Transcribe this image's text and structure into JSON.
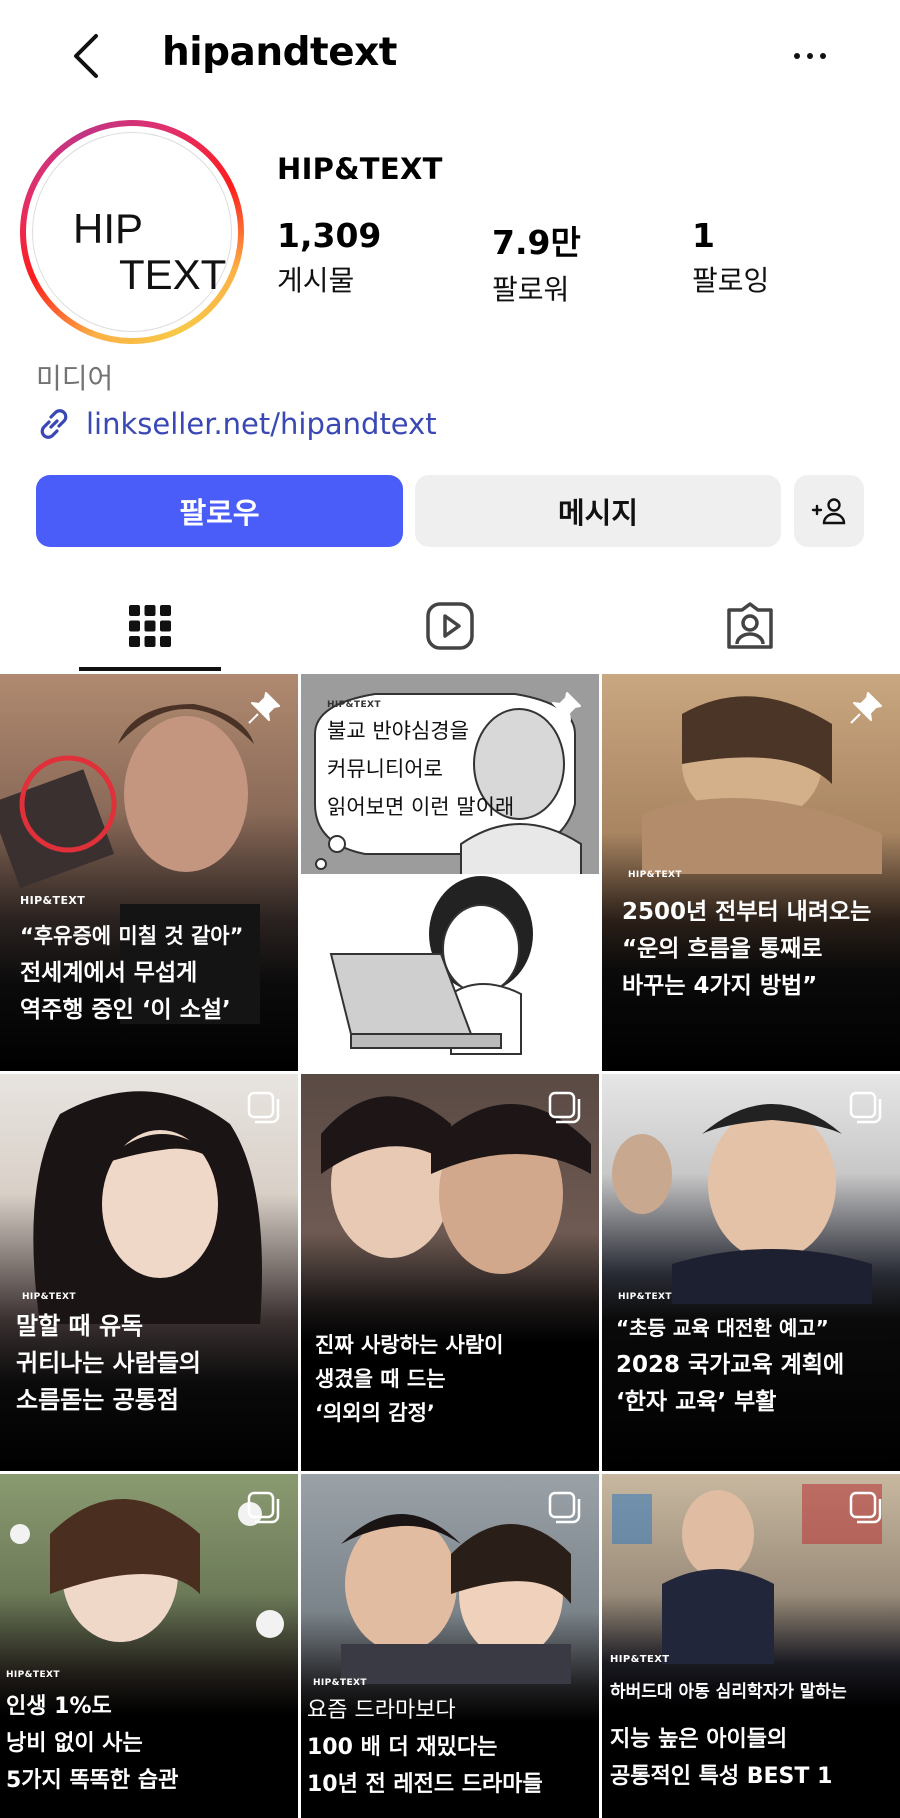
{
  "header": {
    "username": "hipandtext"
  },
  "profile": {
    "avatar_logo_line1": "HIP",
    "avatar_logo_line2": "TEXT",
    "display_name": "HIP&TEXT",
    "stats": {
      "posts": {
        "value": "1,309",
        "label": "게시물"
      },
      "followers": {
        "value": "7.9만",
        "label": "팔로워"
      },
      "following": {
        "value": "1",
        "label": "팔로잉"
      }
    },
    "category": "미디어",
    "link": "linkseller.net/hipandtext"
  },
  "actions": {
    "follow": "팔로우",
    "message": "메시지"
  },
  "tabs": {
    "active": "grid"
  },
  "colors": {
    "accent": "#4a5df9",
    "link": "#3a48b5",
    "secondary_text": "#737373",
    "button_bg": "#efefef"
  },
  "icons": {
    "back": "chevron-left-icon",
    "more": "more-horizontal-icon",
    "link": "link-icon",
    "add_person": "add-person-icon",
    "grid": "grid-icon",
    "reels": "reels-icon",
    "tagged": "tagged-icon",
    "pin": "pin-icon",
    "multi": "carousel-icon"
  },
  "posts": [
    {
      "brand": "HIP&TEXT",
      "pinned": true,
      "lines": [
        "“후유증에 미칠 것 같아”",
        "전세계에서 무섭게",
        "역주행 중인 ‘이 소설’"
      ]
    },
    {
      "brand": "HIP&TEXT",
      "pinned": true,
      "lines": [
        "불교 반야심경을",
        "커뮤니티어로",
        "읽어보면 이런 말이래"
      ]
    },
    {
      "brand": "HIP&TEXT",
      "pinned": true,
      "lines": [
        "2500년 전부터 내려오는",
        "“운의 흐름을 통째로",
        "바꾸는 4가지 방법”"
      ]
    },
    {
      "brand": "HIP&TEXT",
      "pinned": false,
      "lines": [
        "말할 때 유독",
        "귀티나는 사람들의",
        "소름돋는 공통점"
      ]
    },
    {
      "brand": "",
      "pinned": false,
      "lines": [
        "진짜 사랑하는 사람이",
        "생겼을 때 드는",
        "‘의외의 감정’"
      ]
    },
    {
      "brand": "HIP&TEXT",
      "pinned": false,
      "lines": [
        "“초등 교육 대전환 예고”",
        "2028 국가교육 계획에",
        "‘한자 교육’ 부활"
      ]
    },
    {
      "brand": "HIP&TEXT",
      "pinned": false,
      "lines": [
        "인생 1%도",
        "낭비 없이 사는",
        "5가지 똑똑한 습관"
      ]
    },
    {
      "brand": "HIP&TEXT",
      "pinned": false,
      "lines": [
        "요즘 드라마보다",
        "100 배 더 재밌다는",
        "10년 전 레전드 드라마들"
      ]
    },
    {
      "brand": "HIP&TEXT",
      "pinned": false,
      "lines": [
        "하버드대 아동 심리학자가 말하는",
        "지능 높은 아이들의",
        "공통적인 특성 BEST 1"
      ]
    }
  ]
}
